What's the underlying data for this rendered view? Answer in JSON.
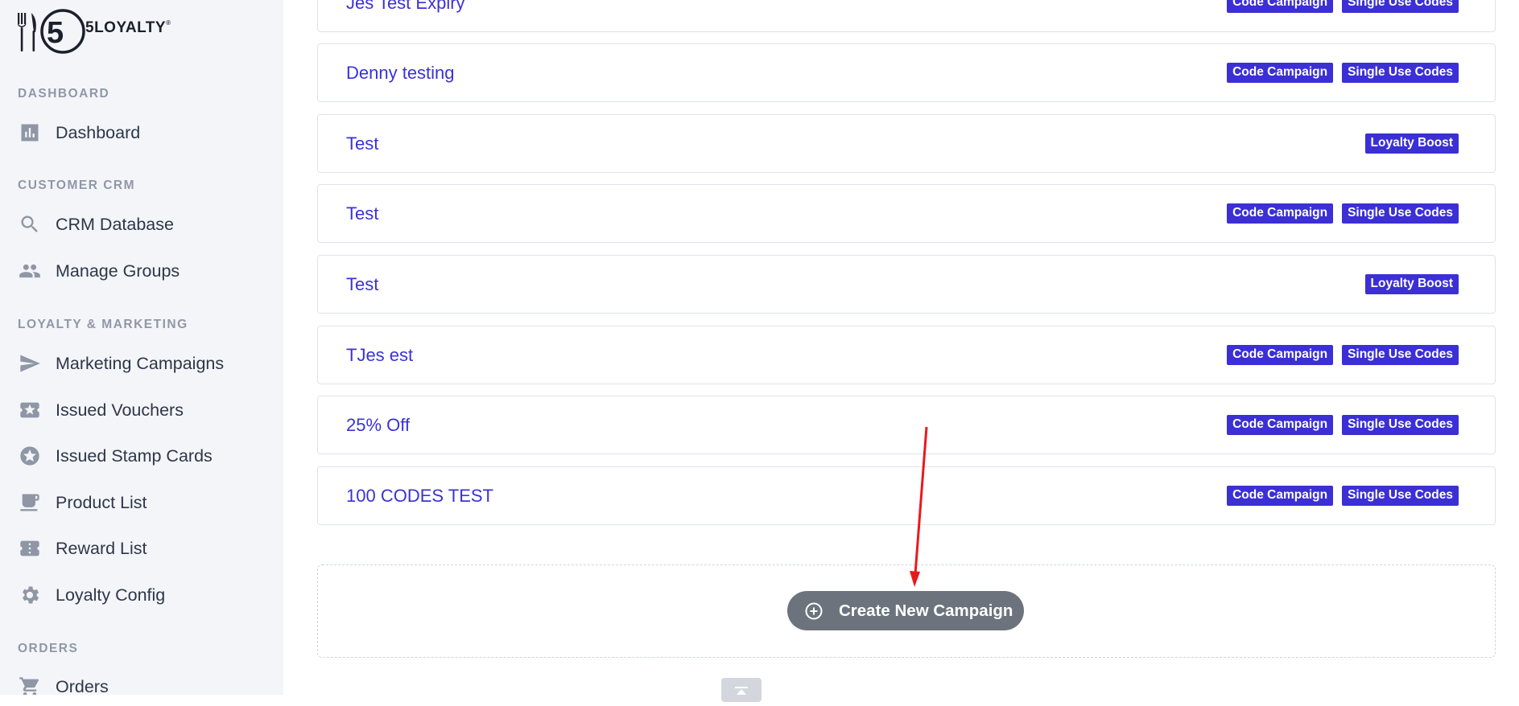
{
  "brand": {
    "logo_text": "5LOYALTY"
  },
  "sidebar": {
    "sections": [
      {
        "title": "DASHBOARD"
      },
      {
        "title": "CUSTOMER CRM"
      },
      {
        "title": "LOYALTY & MARKETING"
      },
      {
        "title": "ORDERS"
      }
    ],
    "items": [
      {
        "label": "Dashboard",
        "icon": "bar-chart-icon"
      },
      {
        "label": "CRM Database",
        "icon": "search-icon"
      },
      {
        "label": "Manage Groups",
        "icon": "people-icon"
      },
      {
        "label": "Marketing Campaigns",
        "icon": "send-icon"
      },
      {
        "label": "Issued Vouchers",
        "icon": "ticket-icon"
      },
      {
        "label": "Issued Stamp Cards",
        "icon": "star-circle-icon"
      },
      {
        "label": "Product List",
        "icon": "coffee-cup-icon"
      },
      {
        "label": "Reward List",
        "icon": "reward-ticket-icon"
      },
      {
        "label": "Loyalty Config",
        "icon": "gear-icon"
      },
      {
        "label": "Orders",
        "icon": "cart-icon"
      }
    ]
  },
  "campaigns": [
    {
      "name": "Jes Test Expiry",
      "badges": [
        "Code Campaign",
        "Single Use Codes"
      ]
    },
    {
      "name": "Denny testing",
      "badges": [
        "Code Campaign",
        "Single Use Codes"
      ]
    },
    {
      "name": "Test",
      "badges": [
        "Loyalty Boost"
      ]
    },
    {
      "name": "Test",
      "badges": [
        "Code Campaign",
        "Single Use Codes"
      ]
    },
    {
      "name": "Test",
      "badges": [
        "Loyalty Boost"
      ]
    },
    {
      "name": "TJes est",
      "badges": [
        "Code Campaign",
        "Single Use Codes"
      ]
    },
    {
      "name": "25% Off",
      "badges": [
        "Code Campaign",
        "Single Use Codes"
      ]
    },
    {
      "name": "100 CODES TEST",
      "badges": [
        "Code Campaign",
        "Single Use Codes"
      ]
    }
  ],
  "create_button": {
    "label": "Create New Campaign",
    "icon": "plus-circle-icon"
  },
  "colors": {
    "accent": "#3b2fd5",
    "link": "#3a32d6",
    "button": "#6c737c",
    "annotation_arrow": "#e8191c"
  }
}
